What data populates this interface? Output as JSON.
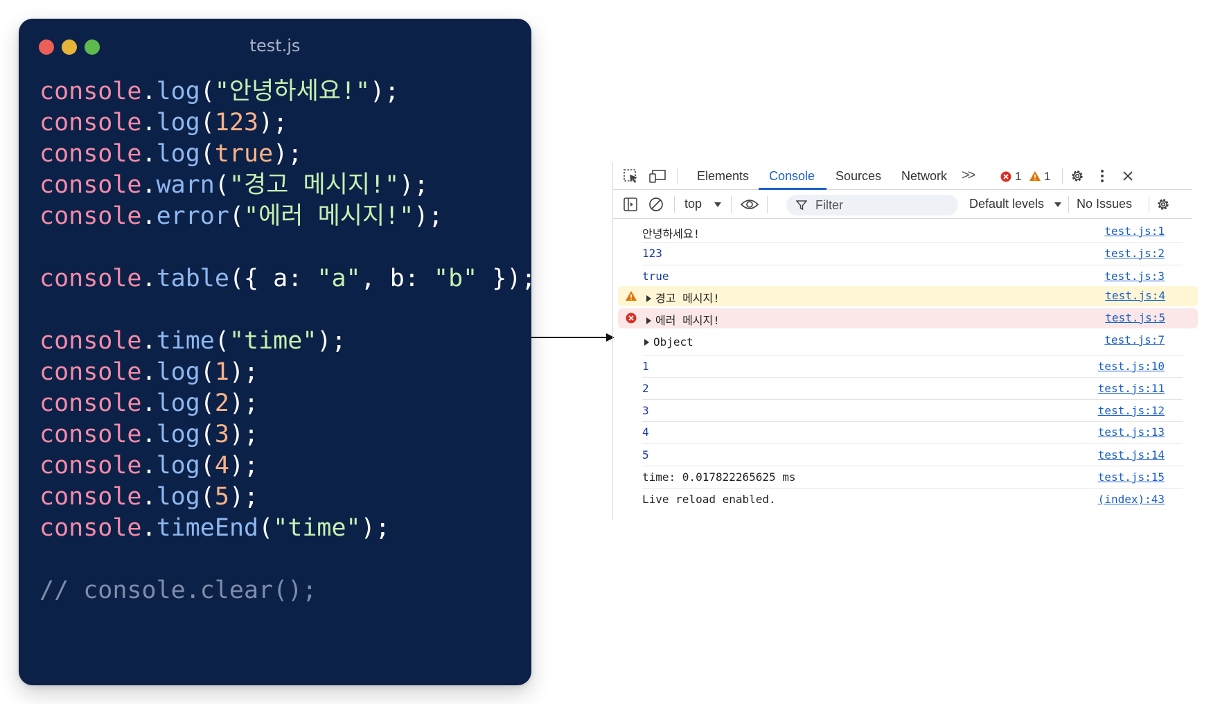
{
  "editor": {
    "filename": "test.js",
    "comment_line": "// console.clear();"
  },
  "devtools": {
    "tabs": [
      "Elements",
      "Console",
      "Sources",
      "Network"
    ],
    "active_tab": "Console",
    "more_tabs_label": ">>",
    "error_count": "1",
    "warning_count": "1",
    "context": "top",
    "filter_placeholder": "Filter",
    "levels": "Default levels",
    "issues": "No Issues",
    "colors": {
      "accent": "#1a5fc8",
      "warn_bg": "#fef6d5",
      "error_bg": "#fbe7e7",
      "editor_bg": "#0c2148"
    },
    "console": [
      {
        "kind": "log",
        "text": "안녕하세요!",
        "source": "test.js:1"
      },
      {
        "kind": "number",
        "text": "123",
        "source": "test.js:2"
      },
      {
        "kind": "boolean",
        "text": "true",
        "source": "test.js:3"
      },
      {
        "kind": "warn",
        "text": "경고 메시지!",
        "source": "test.js:4"
      },
      {
        "kind": "error",
        "text": "에러 메시지!",
        "source": "test.js:5"
      },
      {
        "kind": "table",
        "text": "Object",
        "source": "test.js:7"
      },
      {
        "kind": "number",
        "text": "1",
        "source": "test.js:10"
      },
      {
        "kind": "number",
        "text": "2",
        "source": "test.js:11"
      },
      {
        "kind": "number",
        "text": "3",
        "source": "test.js:12"
      },
      {
        "kind": "number",
        "text": "4",
        "source": "test.js:13"
      },
      {
        "kind": "number",
        "text": "5",
        "source": "test.js:14"
      },
      {
        "kind": "log",
        "text": "time: 0.017822265625 ms",
        "source": "test.js:15"
      },
      {
        "kind": "log",
        "text": "Live reload enabled.",
        "source": "(index):43"
      }
    ]
  }
}
